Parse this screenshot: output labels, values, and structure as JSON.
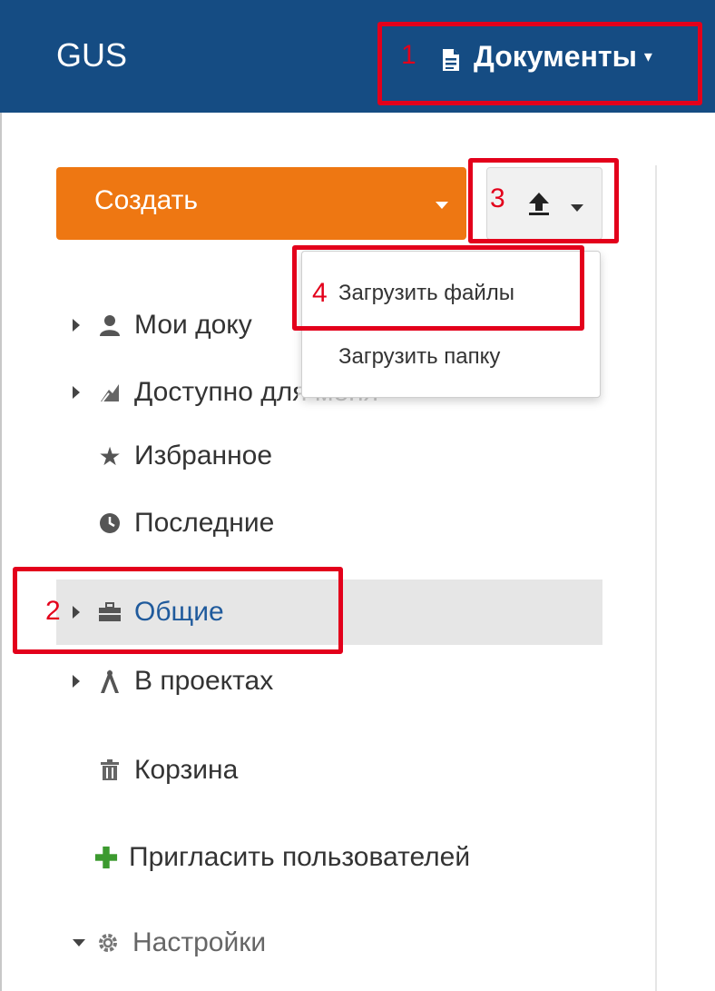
{
  "header": {
    "brand": "GUS",
    "documents_label": "Документы"
  },
  "toolbar": {
    "create_label": "Создать"
  },
  "upload_menu": {
    "items": [
      "Загрузить файлы",
      "Загрузить папку"
    ]
  },
  "sidebar": {
    "items": [
      {
        "label": "Мои доку",
        "icon": "user-icon"
      },
      {
        "label": "Доступно для меня",
        "icon": "share-icon"
      },
      {
        "label": "Избранное",
        "icon": "star-icon"
      },
      {
        "label": "Последние",
        "icon": "clock-icon"
      },
      {
        "label": "Общие",
        "icon": "briefcase-icon"
      },
      {
        "label": "В проектах",
        "icon": "compass-icon"
      },
      {
        "label": "Корзина",
        "icon": "trash-icon"
      },
      {
        "label": "Пригласить пользователей",
        "icon": "plus-icon"
      },
      {
        "label": "Настройки",
        "icon": "gear-icon"
      }
    ]
  },
  "annotations": [
    "1",
    "2",
    "3",
    "4"
  ],
  "colors": {
    "header_bg": "#154c83",
    "create_button": "#ee7712",
    "annotation": "#e3001b",
    "selected_text": "#1f5a9c"
  }
}
